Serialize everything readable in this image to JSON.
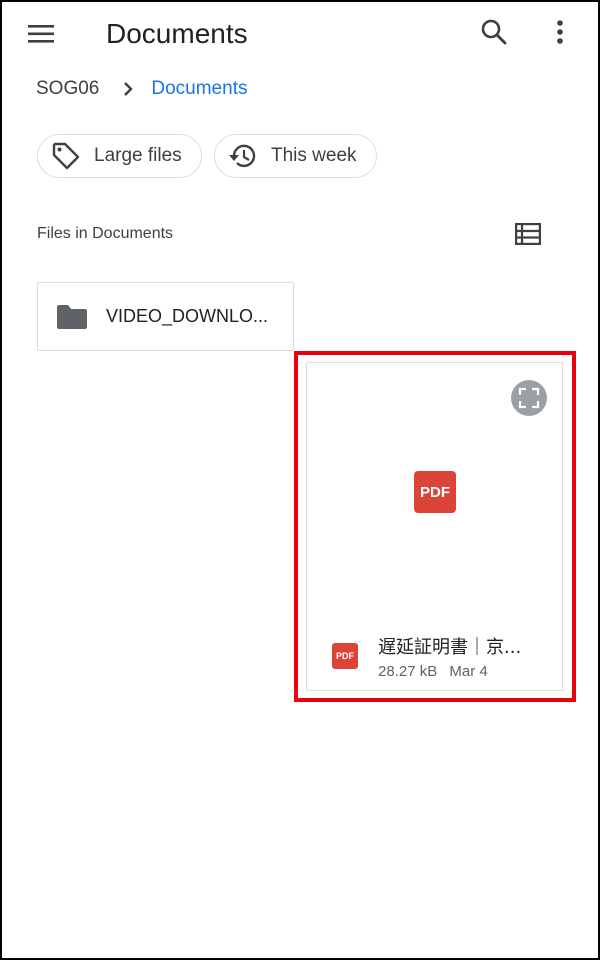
{
  "appbar": {
    "title": "Documents",
    "menu_icon": "menu-icon",
    "search_icon": "search-icon",
    "more_icon": "more-vert-icon"
  },
  "breadcrumb": {
    "root": "SOG06",
    "current": "Documents"
  },
  "chips": [
    {
      "label": "Large files",
      "icon": "tag-icon"
    },
    {
      "label": "This week",
      "icon": "history-icon"
    }
  ],
  "section": {
    "header": "Files in Documents",
    "view_icon": "list-view-icon"
  },
  "folders": [
    {
      "name": "VIDEO_DOWNLO...",
      "icon": "folder-icon"
    }
  ],
  "files": [
    {
      "name": "遅延証明書｜京...",
      "thumb_label": "PDF",
      "type_badge": "PDF",
      "size": "28.27 kB",
      "date": "Mar 4",
      "expand_icon": "expand-icon"
    }
  ],
  "colors": {
    "accent": "#1a73e8",
    "pdf": "#db4437",
    "highlight": "#e8000b"
  }
}
